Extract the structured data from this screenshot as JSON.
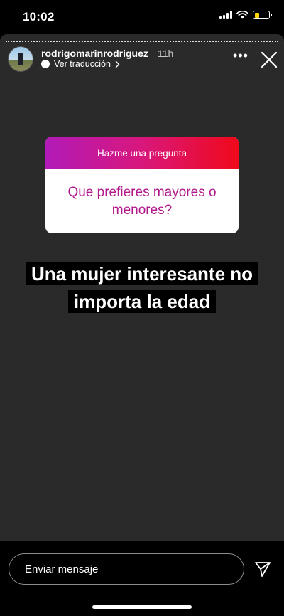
{
  "status_bar": {
    "time": "10:02",
    "battery_level": 0.35,
    "battery_color": "#ffd60a"
  },
  "story": {
    "username": "rodrigomarinrodriguez",
    "time_ago": "11h",
    "translate_label": "Ver traducción",
    "more_icon": "more-horizontal-icon",
    "close_icon": "close-icon"
  },
  "question_sticker": {
    "header": "Hazme una pregunta",
    "question": "Que prefieres mayores o menores?",
    "gradient": [
      "#b21ab8",
      "#d8177c",
      "#f0091a"
    ],
    "question_color": "#b0188c"
  },
  "caption": "Una mujer interesante no importa la edad",
  "bottom_bar": {
    "message_placeholder": "Enviar mensaje",
    "send_icon": "send-icon"
  }
}
